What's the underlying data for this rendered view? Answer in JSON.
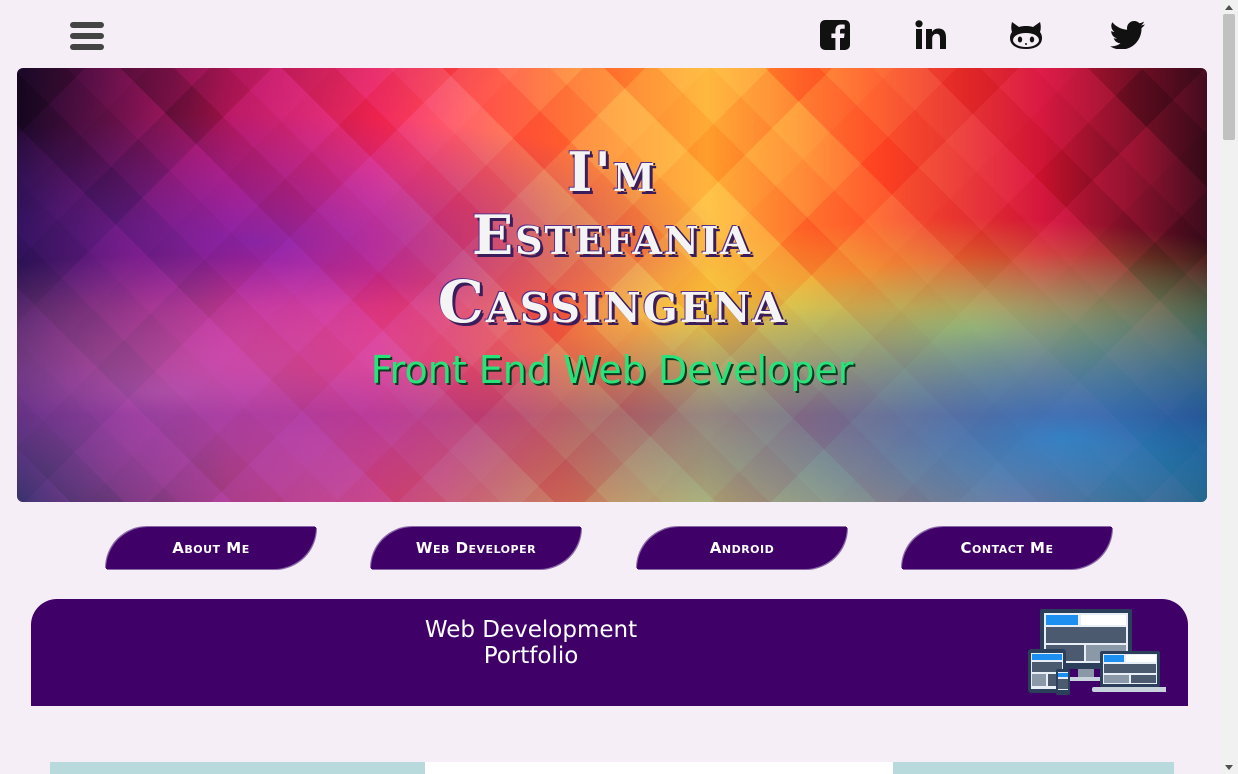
{
  "header": {
    "menu_icon": "hamburger-icon",
    "social_icons": [
      "facebook-icon",
      "linkedin-icon",
      "github-icon",
      "twitter-icon"
    ]
  },
  "hero": {
    "title_lines": [
      "I'm",
      "Estefania",
      "Cassingena"
    ],
    "subtitle": "Front End Web Developer"
  },
  "nav": {
    "buttons": [
      "About Me",
      "Web Developer",
      "Android",
      "Contact Me"
    ]
  },
  "portfolio": {
    "title_line1": "Web Development",
    "title_line2": "Portfolio",
    "illustration": "responsive-devices-icon"
  },
  "colors": {
    "background": "#f6eef6",
    "accent_purple": "#3f0168",
    "subtitle_green": "#29e37a",
    "strip_teal": "#b8dadd"
  }
}
